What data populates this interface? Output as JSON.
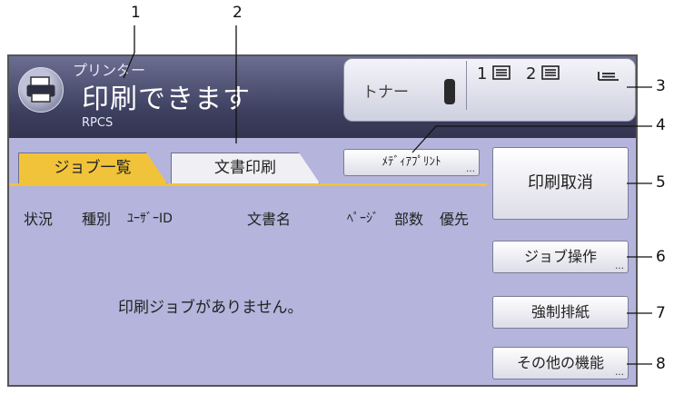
{
  "callouts": [
    "1",
    "2",
    "3",
    "4",
    "5",
    "6",
    "7",
    "8"
  ],
  "header": {
    "mode_label": "プリンター",
    "status_text": "印刷できます",
    "language": "RPCS"
  },
  "toner": {
    "label": "トナー",
    "tray1": "1",
    "tray2": "2"
  },
  "tabs": [
    {
      "label": "ジョブ一覧",
      "active": true
    },
    {
      "label": "文書印刷",
      "active": false
    }
  ],
  "media_print_label": "ﾒﾃﾞｨｱﾌﾟﾘﾝﾄ",
  "table": {
    "columns": [
      "状況",
      "種別",
      "ﾕｰｻﾞｰID",
      "文書名",
      "ﾍﾟｰｼﾞ",
      "部数",
      "優先"
    ],
    "empty_message": "印刷ジョブがありません。"
  },
  "buttons": {
    "cancel_print": "印刷取消",
    "job_operation": "ジョブ操作",
    "form_feed": "強制排紙",
    "other_functions": "その他の機能"
  },
  "colors": {
    "screen_bg": "#b4b4dc",
    "header_bg": "#3c3e5e",
    "active_tab": "#f1c33a"
  },
  "icons": [
    "printer-icon",
    "toner-bar-icon",
    "tray-icon",
    "tray-icon",
    "tray-icon"
  ]
}
